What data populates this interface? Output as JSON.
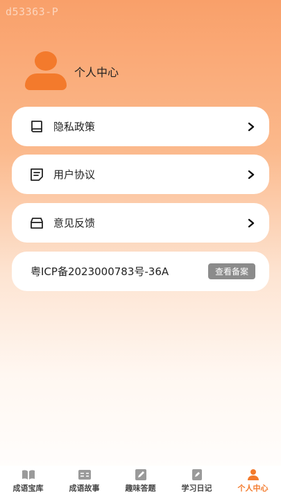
{
  "watermark": "d53363-P",
  "profile": {
    "title": "个人中心",
    "avatar_icon": "user-avatar-icon"
  },
  "menu": [
    {
      "label": "隐私政策",
      "icon": "book-icon"
    },
    {
      "label": "用户协议",
      "icon": "document-icon"
    },
    {
      "label": "意见反馈",
      "icon": "feedback-box-icon"
    }
  ],
  "icp": {
    "text": "粤ICP备2023000783号-36A",
    "button": "查看备案"
  },
  "tabs": [
    {
      "label": "成语宝库",
      "icon": "open-book-icon",
      "active": false
    },
    {
      "label": "成语故事",
      "icon": "story-icon",
      "active": false
    },
    {
      "label": "趣味答题",
      "icon": "edit-icon",
      "active": false
    },
    {
      "label": "学习日记",
      "icon": "notebook-icon",
      "active": false
    },
    {
      "label": "个人中心",
      "icon": "person-icon",
      "active": true
    }
  ],
  "colors": {
    "accent": "#f37a2c",
    "tab_inactive_icon": "#9a9a9a"
  }
}
